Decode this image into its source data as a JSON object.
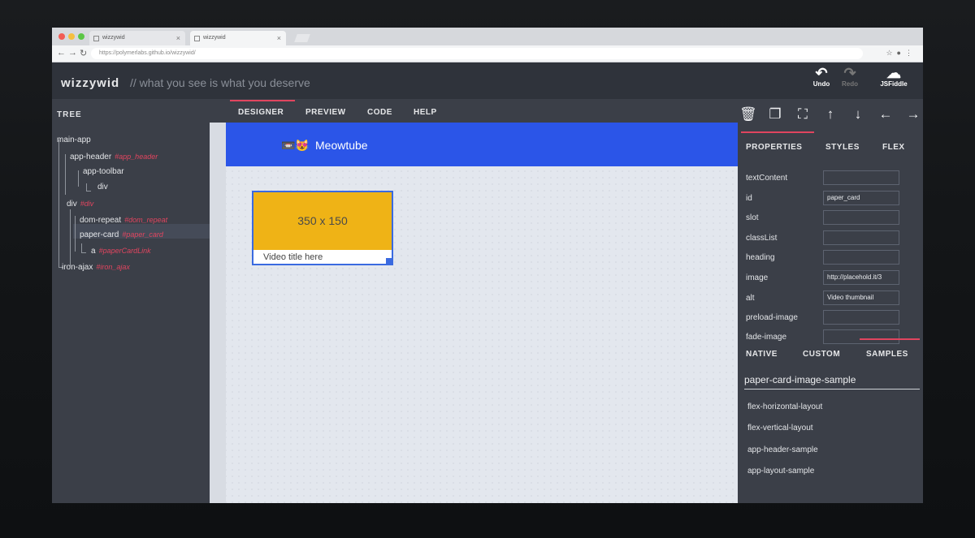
{
  "browser": {
    "tabs": [
      {
        "label": "wizzywid"
      },
      {
        "label": "wizzywid"
      }
    ],
    "url": "https://polymerlabs.github.io/wizzywid/"
  },
  "app": {
    "title": "wizzywid",
    "subtitle": "// what you see is what you deserve",
    "header_buttons": [
      {
        "label": "Undo",
        "icon": "undo-icon",
        "enabled": true
      },
      {
        "label": "Redo",
        "icon": "redo-icon",
        "enabled": false
      },
      {
        "label": "JSFiddle",
        "icon": "cloud-upload-icon",
        "enabled": true
      }
    ]
  },
  "tree": {
    "heading": "TREE",
    "nodes": [
      {
        "name": "main-app",
        "id": ""
      },
      {
        "name": "app-header",
        "id": "#app_header"
      },
      {
        "name": "app-toolbar",
        "id": ""
      },
      {
        "name": "div",
        "id": ""
      },
      {
        "name": "div",
        "id": "#div"
      },
      {
        "name": "dom-repeat",
        "id": "#dom_repeat"
      },
      {
        "name": "paper-card",
        "id": "#paper_card",
        "selected": true
      },
      {
        "name": "a",
        "id": "#paperCardLink"
      },
      {
        "name": "iron-ajax",
        "id": "#iron_ajax"
      }
    ]
  },
  "designer_tabs": [
    "DESIGNER",
    "PREVIEW",
    "CODE",
    "HELP"
  ],
  "active_designer_tab": "DESIGNER",
  "canvas": {
    "app_title": "Meowtube",
    "app_emoji": "📼😻",
    "card_image_text": "350 x 150",
    "card_title": "Video title here"
  },
  "toolbar_icons": [
    "delete-icon",
    "copy-icon",
    "fullscreen-icon",
    "arrow-up-icon",
    "arrow-down-icon",
    "arrow-left-icon",
    "arrow-right-icon"
  ],
  "property_tabs": [
    "PROPERTIES",
    "STYLES",
    "FLEX"
  ],
  "properties": [
    {
      "name": "textContent",
      "value": ""
    },
    {
      "name": "id",
      "value": "paper_card"
    },
    {
      "name": "slot",
      "value": ""
    },
    {
      "name": "classList",
      "value": ""
    },
    {
      "name": "heading",
      "value": ""
    },
    {
      "name": "image",
      "value": "http://placehold.it/3"
    },
    {
      "name": "alt",
      "value": "Video thumbnail"
    },
    {
      "name": "preload-image",
      "value": ""
    },
    {
      "name": "fade-image",
      "value": ""
    }
  ],
  "palette_tabs": [
    "NATIVE",
    "CUSTOM",
    "SAMPLES"
  ],
  "active_palette_tab": "SAMPLES",
  "samples": {
    "search_value": "paper-card-image-sample",
    "items": [
      "flex-horizontal-layout",
      "flex-vertical-layout",
      "app-header-sample",
      "app-layout-sample"
    ]
  },
  "colors": {
    "accent": "#e0455f",
    "app_bar": "#2b55e8",
    "card_image": "#efb316",
    "panel_bg": "#3b3f48"
  }
}
